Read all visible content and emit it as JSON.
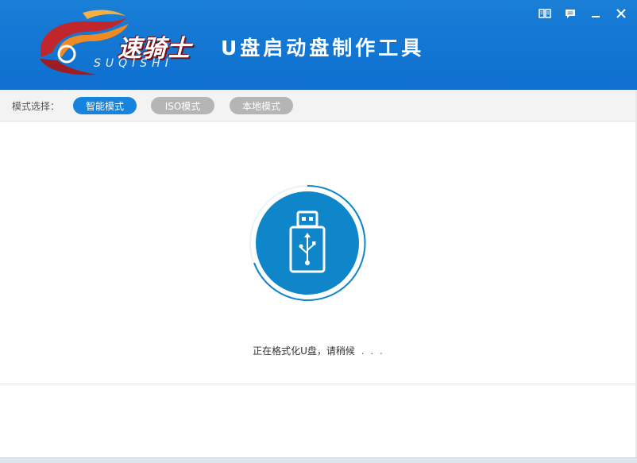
{
  "brand": {
    "logo_text": "速骑士",
    "logo_subtext": "SUQISHI",
    "colors": {
      "flame_red": "#c0272d",
      "flame_orange": "#f08a24",
      "header_blue": "#1377d3"
    }
  },
  "header": {
    "title": "U盘启动盘制作工具",
    "window_buttons": [
      {
        "name": "help-book-icon"
      },
      {
        "name": "feedback-icon"
      },
      {
        "name": "minimize-icon"
      },
      {
        "name": "close-icon"
      }
    ]
  },
  "modebar": {
    "label": "模式选择：",
    "modes": [
      {
        "label": "智能模式",
        "active": true
      },
      {
        "label": "ISO模式",
        "active": false
      },
      {
        "label": "本地模式",
        "active": false
      }
    ]
  },
  "main": {
    "status_text": "正在格式化U盘，请稍候",
    "status_ellipsis": ". . .",
    "icon": "usb-drive-icon",
    "accent": "#0e86c9"
  }
}
